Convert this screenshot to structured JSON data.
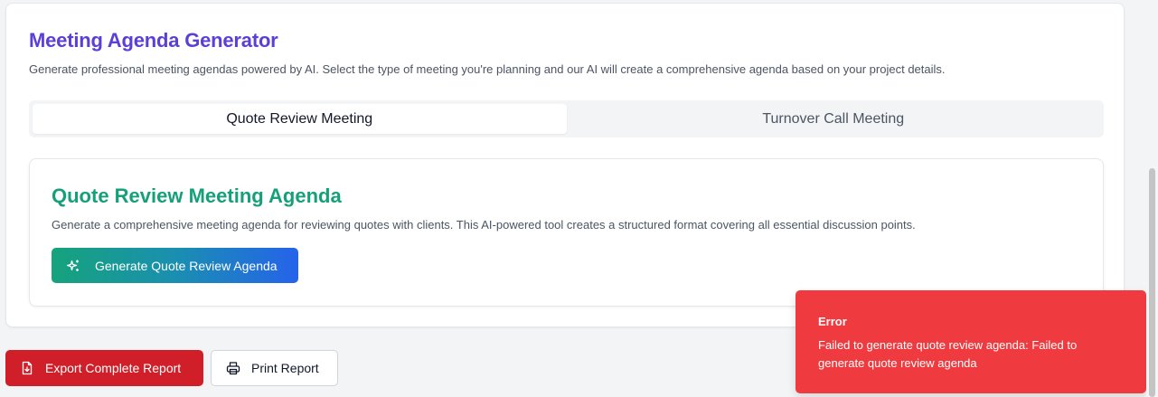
{
  "header": {
    "title": "Meeting Agenda Generator",
    "subtitle": "Generate professional meeting agendas powered by AI. Select the type of meeting you're planning and our AI will create a comprehensive agenda based on your project details."
  },
  "tabs": [
    {
      "label": "Quote Review Meeting",
      "active": true
    },
    {
      "label": "Turnover Call Meeting",
      "active": false
    }
  ],
  "panel": {
    "title": "Quote Review Meeting Agenda",
    "description": "Generate a comprehensive meeting agenda for reviewing quotes with clients. This AI-powered tool creates a structured format covering all essential discussion points.",
    "button_label": "Generate Quote Review Agenda",
    "button_icon": "sparkles-icon"
  },
  "actions": {
    "export_label": "Export Complete Report",
    "export_icon": "file-download-icon",
    "print_label": "Print Report",
    "print_icon": "printer-icon"
  },
  "toast": {
    "title": "Error",
    "message": "Failed to generate quote review agenda: Failed to generate quote review agenda"
  },
  "colors": {
    "title": "#5b3fd6",
    "panel_title": "#16a07a",
    "export_button": "#d01f28",
    "toast_bg": "#ef3b3f"
  }
}
